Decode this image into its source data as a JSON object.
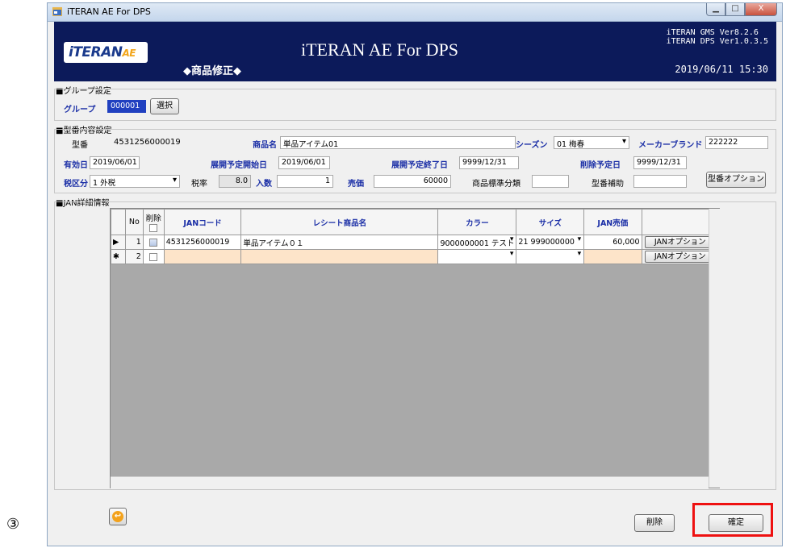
{
  "step_label": "③",
  "window": {
    "title": "iTERAN AE For DPS",
    "controls": {
      "minimize": "▁",
      "maximize": "□",
      "close": "X"
    }
  },
  "header": {
    "logo": "iTERAN",
    "logo_suffix": "AE",
    "app_title": "iTERAN AE For DPS",
    "screen_name": "◆商品修正◆",
    "version_lines": "iTERAN GMS Ver8.2.6\niTERAN DPS Ver1.0.3.5",
    "datetime": "2019/06/11 15:30"
  },
  "group_section": {
    "title": "■グループ設定",
    "group_label": "グループ",
    "group_value": "000001",
    "select_button": "選択"
  },
  "model_section": {
    "title": "■型番内容設定",
    "model_no_label": "型番",
    "model_no_value": "4531256000019",
    "product_name_label": "商品名",
    "product_name_value": "単品アイテム01",
    "season_label": "シーズン",
    "season_value": "01 梅春",
    "maker_brand_label": "メーカーブランド",
    "maker_brand_value": "222222",
    "valid_day_label": "有効日",
    "valid_day_value": "2019/06/01",
    "deploy_start_label": "展開予定開始日",
    "deploy_start_value": "2019/06/01",
    "deploy_end_label": "展開予定終了日",
    "deploy_end_value": "9999/12/31",
    "delete_date_label": "削除予定日",
    "delete_date_value": "9999/12/31",
    "tax_class_label": "税区分",
    "tax_class_value": "1 外税",
    "tax_rate_label": "税率",
    "tax_rate_value": "8.0",
    "quantity_label": "入数",
    "quantity_value": "1",
    "price_label": "売価",
    "price_value": "60000",
    "product_std_label": "商品標準分類",
    "product_std_value": "",
    "model_aux_label": "型番補助",
    "model_aux_value": "",
    "model_option_button": "型番オプション"
  },
  "jan_section": {
    "title": "■JAN詳細情報",
    "columns": {
      "no": "No",
      "delete": "削除",
      "jan_code": "JANコード",
      "receipt_name": "レシート商品名",
      "color": "カラー",
      "size": "サイズ",
      "jan_price": "JAN売価"
    },
    "rows": [
      {
        "marker": "▶",
        "no": "1",
        "jan_code": "4531256000019",
        "receipt_name": "単品アイテム０１",
        "color": "9000000001 テスト",
        "size": "21 999000000",
        "jan_price": "60,000",
        "option_button": "JANオプション"
      },
      {
        "marker": "✱",
        "no": "2",
        "jan_code": "",
        "receipt_name": "",
        "color": "",
        "size": "",
        "jan_price": "",
        "option_button": "JANオプション"
      }
    ]
  },
  "footer": {
    "delete_button": "削除",
    "confirm_button": "確定"
  }
}
